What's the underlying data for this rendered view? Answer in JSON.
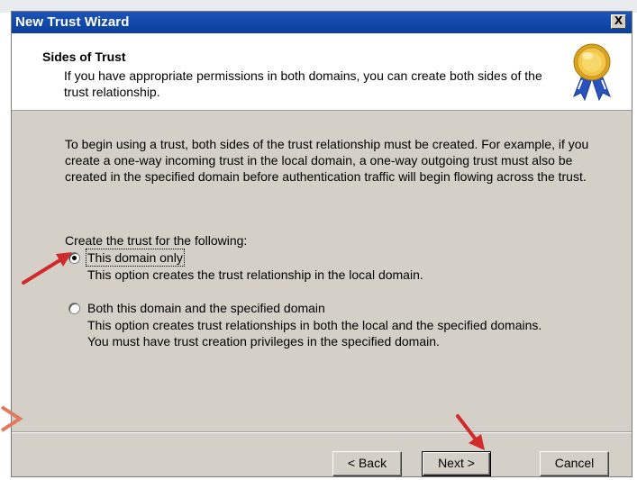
{
  "window": {
    "title": "New Trust Wizard",
    "close_label": "X"
  },
  "header": {
    "title": "Sides of Trust",
    "description": "If you have appropriate permissions in both domains, you can create both sides of the trust relationship.",
    "icon": "award-medal-icon"
  },
  "body": {
    "intro": "To begin using a trust, both sides of the trust relationship must be created. For example, if you create a one-way incoming trust in the local domain, a one-way outgoing trust must also be created in the specified domain before authentication traffic will begin flowing across the trust.",
    "prompt": "Create the trust for the following:",
    "options": [
      {
        "label": "This domain only",
        "description": "This option creates the trust relationship in the local domain.",
        "selected": true
      },
      {
        "label": "Both this domain and the specified domain",
        "description_line1": "This option creates trust relationships in both the local and the specified domains.",
        "description_line2": "You must have trust creation privileges in the specified domain.",
        "selected": false
      }
    ]
  },
  "buttons": {
    "back": "< Back",
    "next": "Next >",
    "cancel": "Cancel"
  },
  "annotation_color": "#d12a2a",
  "title_bar_color": "#0a3f9c"
}
